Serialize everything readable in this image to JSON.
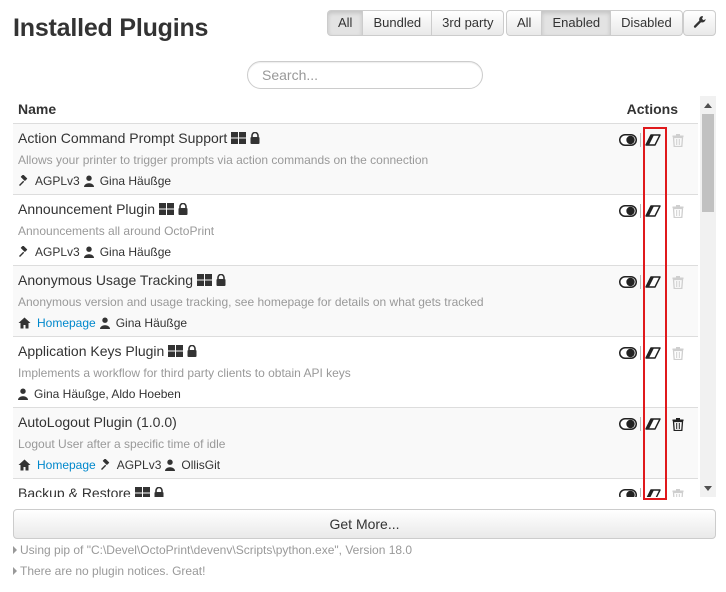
{
  "page": {
    "title": "Installed Plugins"
  },
  "filters": {
    "source": [
      {
        "label": "All",
        "active": true
      },
      {
        "label": "Bundled",
        "active": false
      },
      {
        "label": "3rd party",
        "active": false
      }
    ],
    "status": [
      {
        "label": "All",
        "active": false
      },
      {
        "label": "Enabled",
        "active": true
      },
      {
        "label": "Disabled",
        "active": false
      }
    ],
    "settings_icon": "wrench-icon"
  },
  "search": {
    "placeholder": "Search...",
    "value": ""
  },
  "list": {
    "header_name": "Name",
    "header_actions": "Actions",
    "plugins": [
      {
        "name": "Action Command Prompt Support",
        "bundled": true,
        "locked": true,
        "description": "Allows your printer to trigger prompts via action commands on the connection",
        "homepage": "",
        "license": "AGPLv3",
        "authors": "Gina Häußge",
        "enabled": true,
        "uninstallable": false
      },
      {
        "name": "Announcement Plugin",
        "bundled": true,
        "locked": true,
        "description": "Announcements all around OctoPrint",
        "homepage": "",
        "license": "AGPLv3",
        "authors": "Gina Häußge",
        "enabled": true,
        "uninstallable": false
      },
      {
        "name": "Anonymous Usage Tracking",
        "bundled": true,
        "locked": true,
        "description": "Anonymous version and usage tracking, see homepage for details on what gets tracked",
        "homepage": "Homepage",
        "license": "",
        "authors": "Gina Häußge",
        "enabled": true,
        "uninstallable": false
      },
      {
        "name": "Application Keys Plugin",
        "bundled": true,
        "locked": true,
        "description": "Implements a workflow for third party clients to obtain API keys",
        "homepage": "",
        "license": "",
        "authors": "Gina Häußge, Aldo Hoeben",
        "enabled": true,
        "uninstallable": false
      },
      {
        "name": "AutoLogout Plugin (1.0.0)",
        "bundled": false,
        "locked": false,
        "description": "Logout User after a specific time of idle",
        "homepage": "Homepage",
        "license": "AGPLv3",
        "authors": "OllisGit",
        "enabled": true,
        "uninstallable": true
      },
      {
        "name": "Backup & Restore",
        "bundled": true,
        "locked": true,
        "description": "",
        "homepage": "",
        "license": "",
        "authors": "",
        "enabled": true,
        "uninstallable": false
      }
    ]
  },
  "get_more": {
    "label": "Get More..."
  },
  "notes": {
    "pip": "Using pip of \"C:\\Devel\\OctoPrint\\devenv\\Scripts\\python.exe\", Version 18.0",
    "notices": "There are no plugin notices. Great!"
  },
  "colors": {
    "link": "#0088cc",
    "muted_text": "#999999",
    "highlight_border": "#e0191c",
    "row_stripe": "#f9f9f9"
  }
}
